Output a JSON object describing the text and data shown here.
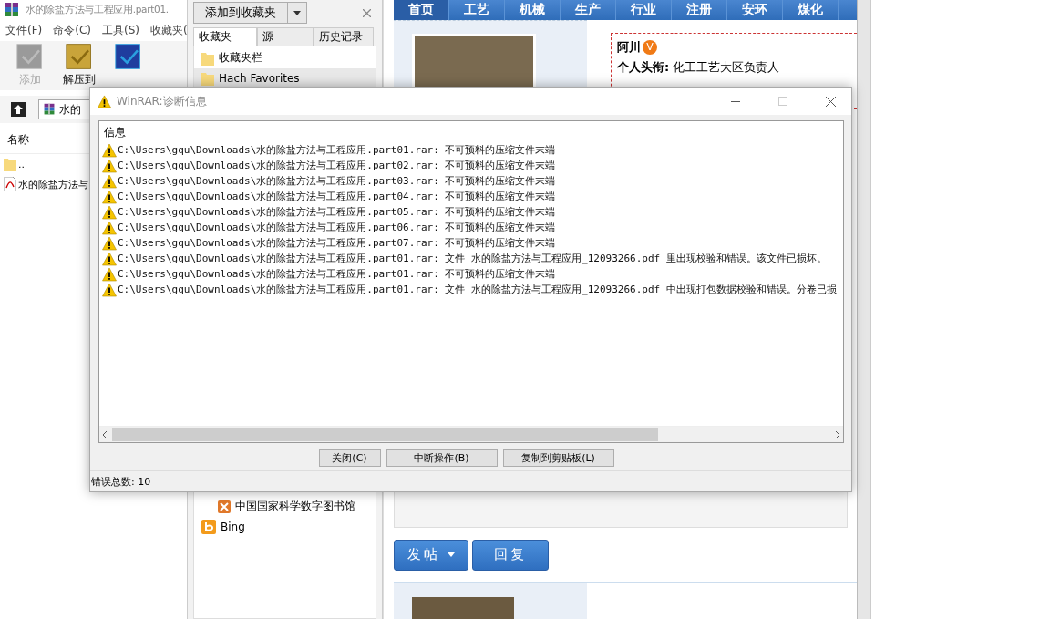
{
  "winrar_window": {
    "title": "水的除盐方法与工程应用.part01.",
    "menu": [
      "文件(F)",
      "命令(C)",
      "工具(S)",
      "收藏夹("
    ],
    "toolbar": [
      {
        "label": "添加",
        "disabled": true
      },
      {
        "label": "解压到",
        "disabled": false
      }
    ],
    "address": "水的",
    "column": "名称",
    "files": [
      {
        "name": "..",
        "kind": "folder"
      },
      {
        "name": "水的除盐方法与",
        "kind": "pdf"
      }
    ]
  },
  "favorites_panel": {
    "add_button": "添加到收藏夹",
    "tabs": [
      {
        "label": "收藏夹",
        "selected": true
      },
      {
        "label": "源",
        "selected": false
      },
      {
        "label": "历史记录",
        "selected": false
      }
    ],
    "items": [
      {
        "label": "收藏夹栏",
        "selected": false
      },
      {
        "label": "Hach Favorites",
        "selected": true
      }
    ],
    "lower_items": [
      {
        "label": "中国国家科学数字图书馆",
        "kind": "library"
      },
      {
        "label": "Bing",
        "kind": "search"
      }
    ]
  },
  "web_page": {
    "nav": [
      {
        "label": "首页",
        "selected": true
      },
      {
        "label": "工艺",
        "selected": false
      },
      {
        "label": "机械",
        "selected": false
      },
      {
        "label": "生产",
        "selected": false
      },
      {
        "label": "行业",
        "selected": false
      },
      {
        "label": "注册",
        "selected": false
      },
      {
        "label": "安环",
        "selected": false
      },
      {
        "label": "煤化",
        "selected": false
      }
    ],
    "post": {
      "author": "阿川",
      "badge": "V",
      "title_label": "个人头衔:",
      "title_value": "化工工艺大区负责人"
    },
    "buttons": [
      {
        "label": "发帖",
        "kind": "dropdown"
      },
      {
        "label": "回复",
        "kind": "plain"
      }
    ]
  },
  "dialog": {
    "title": "WinRAR:诊断信息",
    "column": "信息",
    "messages": [
      "C:\\Users\\gqu\\Downloads\\水的除盐方法与工程应用.part01.rar: 不可预料的压缩文件末端",
      "C:\\Users\\gqu\\Downloads\\水的除盐方法与工程应用.part02.rar: 不可预料的压缩文件末端",
      "C:\\Users\\gqu\\Downloads\\水的除盐方法与工程应用.part03.rar: 不可预料的压缩文件末端",
      "C:\\Users\\gqu\\Downloads\\水的除盐方法与工程应用.part04.rar: 不可预料的压缩文件末端",
      "C:\\Users\\gqu\\Downloads\\水的除盐方法与工程应用.part05.rar: 不可预料的压缩文件末端",
      "C:\\Users\\gqu\\Downloads\\水的除盐方法与工程应用.part06.rar: 不可预料的压缩文件末端",
      "C:\\Users\\gqu\\Downloads\\水的除盐方法与工程应用.part07.rar: 不可预料的压缩文件末端",
      "C:\\Users\\gqu\\Downloads\\水的除盐方法与工程应用.part01.rar: 文件 水的除盐方法与工程应用_12093266.pdf 里出现校验和错误。该文件已损坏。",
      "C:\\Users\\gqu\\Downloads\\水的除盐方法与工程应用.part01.rar: 不可预料的压缩文件末端",
      "C:\\Users\\gqu\\Downloads\\水的除盐方法与工程应用.part01.rar: 文件 水的除盐方法与工程应用_12093266.pdf 中出现打包数据校验和错误。分卷已损"
    ],
    "buttons": [
      "关闭(C)",
      "中断操作(B)",
      "复制到剪贴板(L)"
    ],
    "status": "错误总数: 10"
  }
}
